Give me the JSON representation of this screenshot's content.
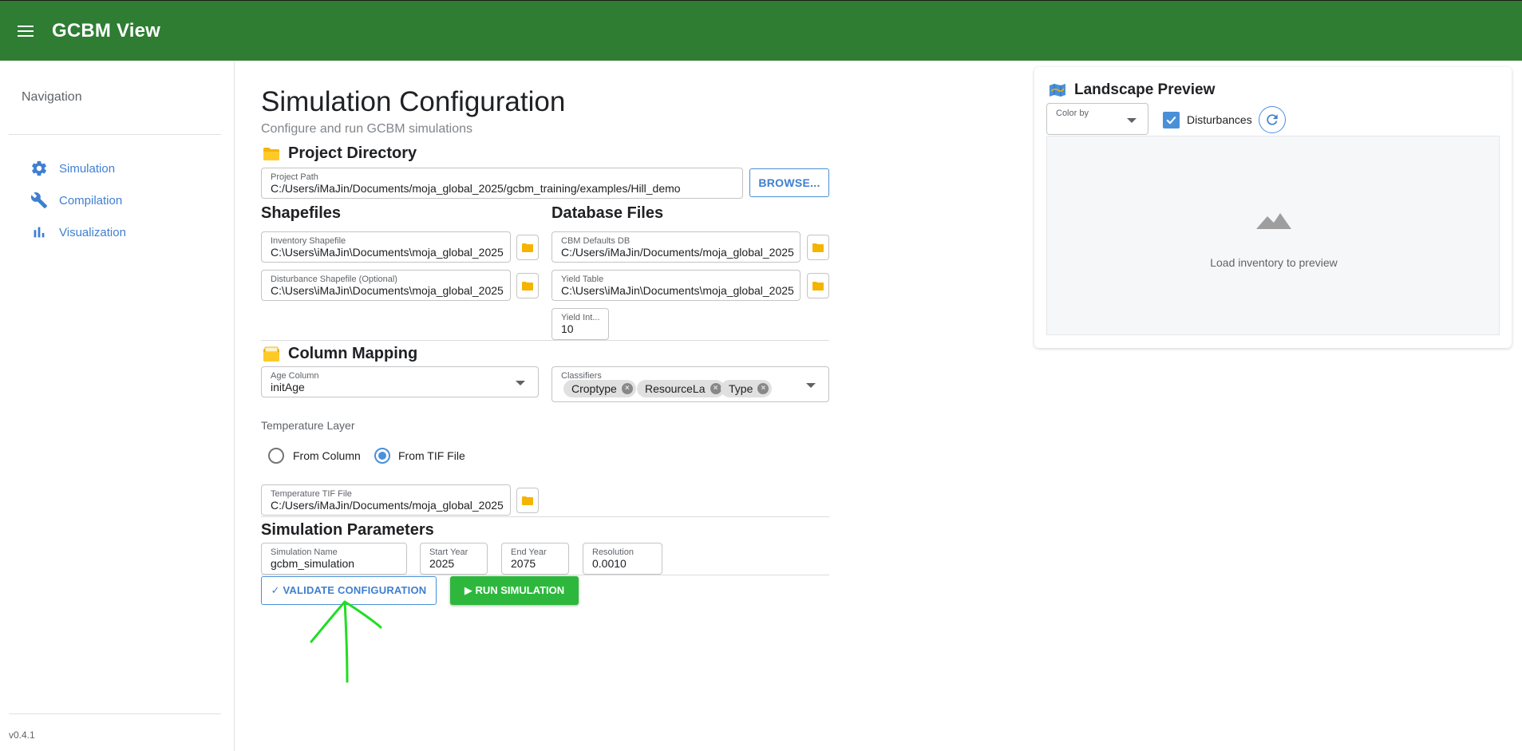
{
  "app": {
    "title": "GCBM View",
    "version": "v0.4.1"
  },
  "sidebar": {
    "heading": "Navigation",
    "items": [
      {
        "label": "Simulation",
        "icon": "gear-icon"
      },
      {
        "label": "Compilation",
        "icon": "wrench-icon"
      },
      {
        "label": "Visualization",
        "icon": "bar-chart-icon"
      }
    ]
  },
  "page": {
    "title": "Simulation Configuration",
    "subtitle": "Configure and run GCBM simulations"
  },
  "project": {
    "section_title": "Project Directory",
    "path_label": "Project Path",
    "path_value": "C:/Users/iMaJin/Documents/moja_global_2025/gcbm_training/examples/Hill_demo",
    "browse_label": "BROWSE..."
  },
  "shapefiles": {
    "section_title": "Shapefiles",
    "inventory_label": "Inventory Shapefile",
    "inventory_value": "C:\\Users\\iMaJin\\Documents\\moja_global_2025",
    "disturbance_label": "Disturbance Shapefile (Optional)",
    "disturbance_value": "C:\\Users\\iMaJin\\Documents\\moja_global_2025"
  },
  "database": {
    "section_title": "Database Files",
    "cbm_label": "CBM Defaults DB",
    "cbm_value": "C:/Users/iMaJin/Documents/moja_global_2025",
    "yield_label": "Yield Table",
    "yield_value": "C:\\Users\\iMaJin\\Documents\\moja_global_2025",
    "yield_int_label": "Yield Int...",
    "yield_int_value": "10"
  },
  "mapping": {
    "section_title": "Column Mapping",
    "age_label": "Age Column",
    "age_value": "initAge",
    "classifiers_label": "Classifiers",
    "classifiers": [
      "Croptype",
      "ResourceLa",
      "Type"
    ],
    "temperature_label": "Temperature Layer",
    "radio_column": "From Column",
    "radio_tif": "From TIF File",
    "tif_label": "Temperature TIF File",
    "tif_value": "C:/Users/iMaJin/Documents/moja_global_2025"
  },
  "params": {
    "section_title": "Simulation Parameters",
    "name_label": "Simulation Name",
    "name_value": "gcbm_simulation",
    "start_label": "Start Year",
    "start_value": "2025",
    "end_label": "End Year",
    "end_value": "2075",
    "resolution_label": "Resolution",
    "resolution_value": "0.0010"
  },
  "actions": {
    "validate_label": "✓ VALIDATE CONFIGURATION",
    "run_label": "▶ RUN SIMULATION"
  },
  "preview": {
    "title": "Landscape Preview",
    "color_by_label": "Color by",
    "disturbances_label": "Disturbances",
    "disturbances_checked": true,
    "empty_text": "Load inventory to preview"
  },
  "colors": {
    "appbar": "#2e7d32",
    "accent": "#4a90d9",
    "run_button": "#2db83d",
    "annotation": "#22dd22"
  }
}
